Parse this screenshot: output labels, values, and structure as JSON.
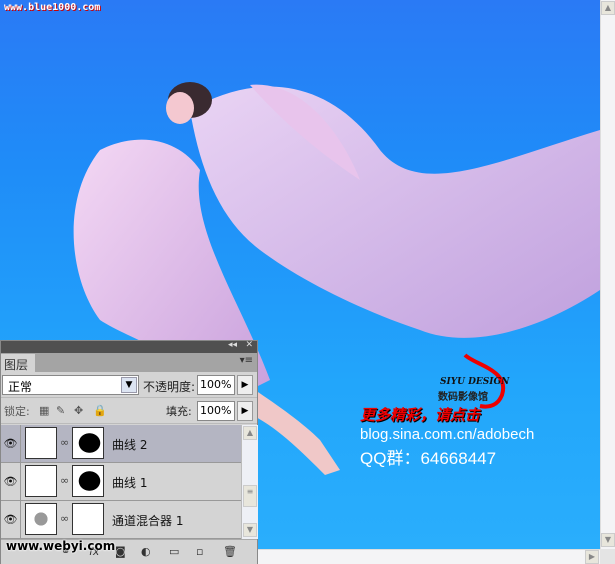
{
  "watermark_top": "www.blue1000.com",
  "watermark_bottom": "www.webyi.com",
  "logo": {
    "brand": "SIYU DESIGN",
    "brand_cn": "数码影像馆",
    "promo": "更多精彩，请点击",
    "blog": "blog.sina.com.cn/adobech",
    "qq": "QQ群：64668447"
  },
  "panel": {
    "tab": "图层",
    "blend_mode": "正常",
    "opacity_label": "不透明度:",
    "opacity": "100%",
    "lock_label": "锁定:",
    "fill_label": "填充:",
    "fill": "100%",
    "layers": [
      {
        "name": "曲线 2",
        "active": true
      },
      {
        "name": "曲线 1",
        "active": false
      },
      {
        "name": "通道混合器 1",
        "active": false
      }
    ]
  },
  "colors": {
    "sky": "#1f8cf8",
    "panel": "#d4d4d4",
    "active_layer": "#b4b5c2"
  }
}
